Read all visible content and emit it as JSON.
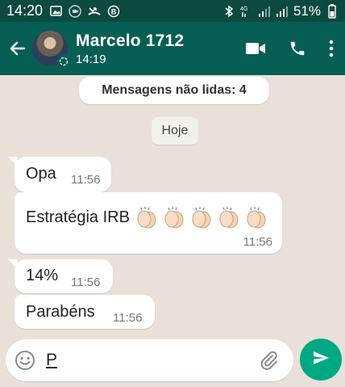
{
  "status_bar": {
    "time": "14:20",
    "left_icons": [
      "image-icon",
      "camera-icon",
      "missed-call-icon",
      "b-circle-icon"
    ],
    "right_icons": [
      "bluetooth-icon",
      "signal-4g-icon",
      "signal-bars-icon",
      "signal-bars-icon"
    ],
    "battery_text": "51%"
  },
  "header": {
    "contact_name": "Marcelo 1712",
    "subtitle": "14:19",
    "icons": [
      "back-arrow-icon",
      "avatar",
      "video-call-icon",
      "voice-call-icon",
      "more-options-icon"
    ]
  },
  "chat": {
    "unread_banner": "Mensagens não lidas: 4",
    "date_chip": "Hoje",
    "messages": [
      {
        "text": "Opa",
        "time": "11:56"
      },
      {
        "text": "Estratégia IRB",
        "emoji": "👏👏👏👏👏",
        "time": "11:56"
      },
      {
        "text": "14%",
        "time": "11:56"
      },
      {
        "text": "Parabéns",
        "time": "11:56"
      }
    ]
  },
  "composer": {
    "value": "P",
    "icons": [
      "emoji-icon",
      "attach-icon",
      "send-icon"
    ]
  },
  "colors": {
    "header_bg": "#075e54",
    "status_bar_bg": "#0c4a40",
    "chat_bg": "#e9e1d8",
    "send_button": "#00a884"
  }
}
